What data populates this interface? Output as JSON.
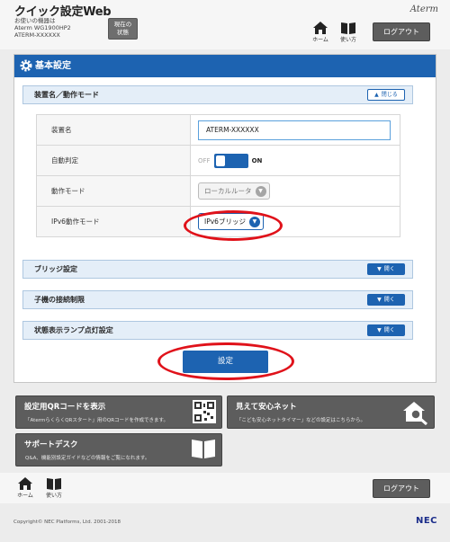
{
  "header": {
    "app_title": "クイック設定Web",
    "device_label": "お使いの機器は",
    "device_model": "Aterm WG1900HP2",
    "device_name": "ATERM-XXXXXX",
    "current_status_line1": "現在の",
    "current_status_line2": "状態",
    "brand": "Aterm",
    "home_label": "ホーム",
    "howto_label": "使い方",
    "logout_label": "ログアウト"
  },
  "panel": {
    "title": "基本設定",
    "section_device": {
      "title": "装置名／動作モード",
      "toggle_label": "閉じる"
    },
    "rows": {
      "device_name_label": "装置名",
      "device_name_value": "ATERM-XXXXXX",
      "auto_detect_label": "自動判定",
      "auto_detect_off": "OFF",
      "auto_detect_on": "ON",
      "mode_label": "動作モード",
      "mode_value": "ローカルルータ",
      "ipv6_label": "IPv6動作モード",
      "ipv6_value": "IPv6ブリッジ"
    },
    "sections": [
      {
        "title": "ブリッジ設定",
        "toggle_label": "開く"
      },
      {
        "title": "子機の接続制限",
        "toggle_label": "開く"
      },
      {
        "title": "状態表示ランプ点灯設定",
        "toggle_label": "開く"
      }
    ],
    "submit_label": "設定"
  },
  "tiles": {
    "qr": {
      "title": "設定用QRコードを表示",
      "sub": "「AtermらくらくQRスタート」用のQRコードを作成できます。"
    },
    "mimamori": {
      "title": "見えて安心ネット",
      "sub": "「こども安心ネットタイマー」などの設定はこちらから。"
    },
    "support": {
      "title": "サポートデスク",
      "sub": "Q&A、機能別設定ガイドなどの情報をご覧になれます。"
    }
  },
  "footer": {
    "home_label": "ホーム",
    "howto_label": "使い方",
    "logout_label": "ログアウト",
    "copyright": "Copyright© NEC Platforms, Ltd. 2001-2018",
    "nec_logo": "NEC"
  },
  "colors": {
    "accent": "#1d63b1",
    "highlight_oval": "#e0121a",
    "tile_bg": "#5d5d5d"
  },
  "icons": [
    "home-icon",
    "book-icon",
    "gear-icon",
    "qr-code-icon",
    "house-search-icon",
    "open-book-icon",
    "chevron-down-icon",
    "chevron-up-icon"
  ]
}
